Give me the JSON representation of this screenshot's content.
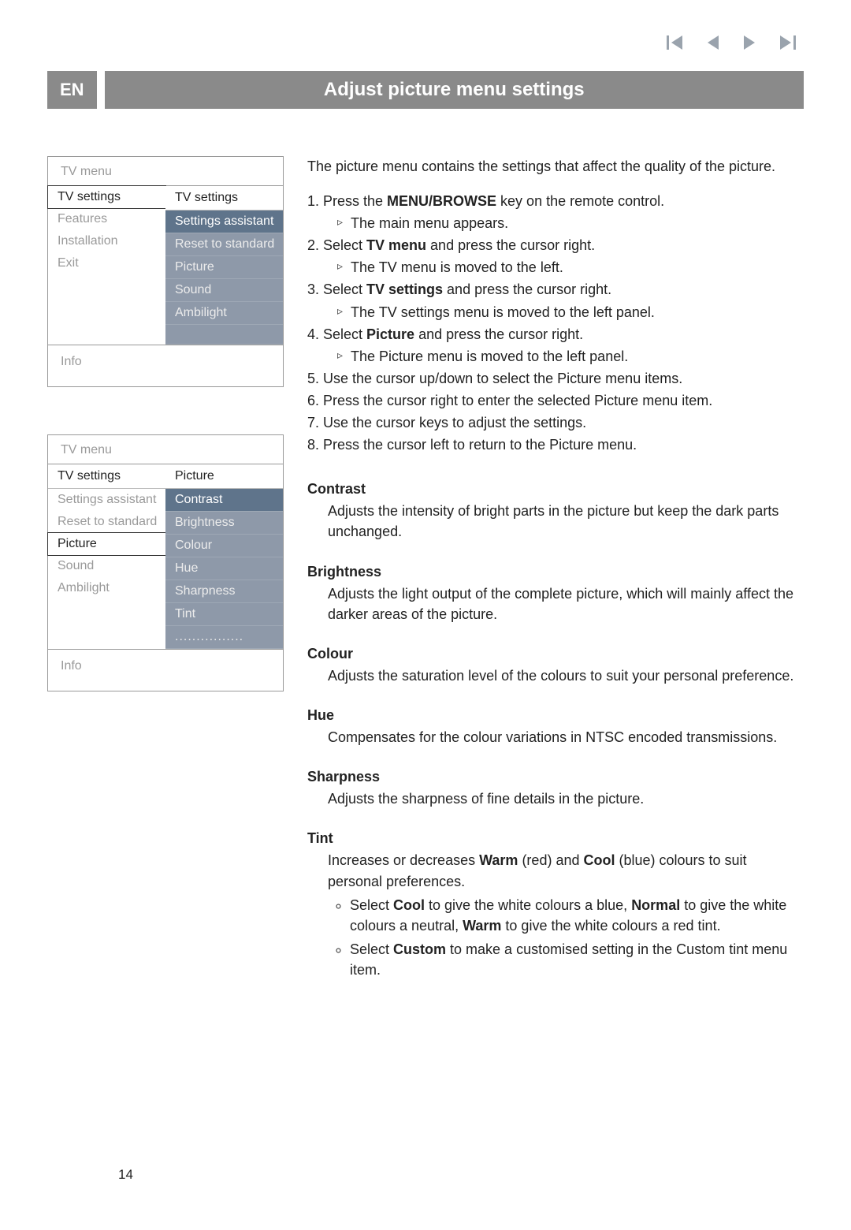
{
  "lang": "EN",
  "title": "Adjust picture menu settings",
  "nav_icons": [
    "first-icon",
    "back-icon",
    "play-icon",
    "last-icon"
  ],
  "menu1": {
    "title": "TV menu",
    "left_head": "TV settings",
    "left": [
      "TV settings",
      "Features",
      "Installation",
      "Exit"
    ],
    "left_selected": "TV settings",
    "right_head": "TV settings",
    "right": [
      "Settings assistant",
      "Reset to standard",
      "Picture",
      "Sound",
      "Ambilight"
    ],
    "right_selected": "Settings assistant",
    "info": "Info"
  },
  "menu2": {
    "title": "TV menu",
    "left_head": "TV settings",
    "left": [
      "Settings assistant",
      "Reset to standard",
      "Picture",
      "Sound",
      "Ambilight"
    ],
    "left_selected": "Picture",
    "right_head": "Picture",
    "right": [
      "Contrast",
      "Brightness",
      "Colour",
      "Hue",
      "Sharpness",
      "Tint",
      "................"
    ],
    "right_selected": "Contrast",
    "info": "Info"
  },
  "intro": "The picture menu contains the settings that affect the quality of the picture.",
  "steps": [
    {
      "pre": "Press the ",
      "b": "MENU/BROWSE",
      "post": " key on the remote control.",
      "sub": "The main menu appears."
    },
    {
      "pre": "Select ",
      "b": "TV menu",
      "post": " and press the cursor right.",
      "sub": "The TV menu is moved to the left."
    },
    {
      "pre": "Select ",
      "b": "TV settings",
      "post": " and press the cursor right.",
      "sub": "The TV settings menu is moved to the left panel."
    },
    {
      "pre": "Select ",
      "b": "Picture",
      "post": " and press the cursor right.",
      "sub": "The Picture menu is moved to the left panel."
    },
    {
      "plain": "Use the cursor up/down to select the Picture menu items."
    },
    {
      "plain": "Press the cursor right to enter the selected Picture menu item."
    },
    {
      "plain": "Use the cursor keys to adjust the settings."
    },
    {
      "plain": "Press the cursor left to return to the Picture menu."
    }
  ],
  "sections": [
    {
      "head": "Contrast",
      "body": "Adjusts the intensity of bright parts in the picture but keep the dark parts unchanged."
    },
    {
      "head": "Brightness",
      "body": "Adjusts the light output of the complete picture, which will mainly affect the darker areas of the picture."
    },
    {
      "head": "Colour",
      "body": "Adjusts the saturation level of the colours to suit your personal preference."
    },
    {
      "head": "Hue",
      "body": "Compensates for the colour variations in NTSC encoded transmissions."
    },
    {
      "head": "Sharpness",
      "body": "Adjusts the sharpness of fine details in the picture."
    }
  ],
  "tint": {
    "head": "Tint",
    "body_pre": "Increases or decreases ",
    "warm": "Warm",
    "body_mid1": " (red) and ",
    "cool": "Cool",
    "body_mid2": " (blue) colours to suit personal preferences.",
    "tip1_pre": "Select ",
    "tip1_b1": "Cool",
    "tip1_mid1": " to give the white colours a blue, ",
    "tip1_b2": "Normal",
    "tip1_mid2": " to give the white colours a neutral, ",
    "tip1_b3": "Warm",
    "tip1_post": " to give the white colours a red tint.",
    "tip2_pre": "Select ",
    "tip2_b": "Custom",
    "tip2_post": " to make a customised setting in the Custom tint menu item."
  },
  "page_number": "14"
}
